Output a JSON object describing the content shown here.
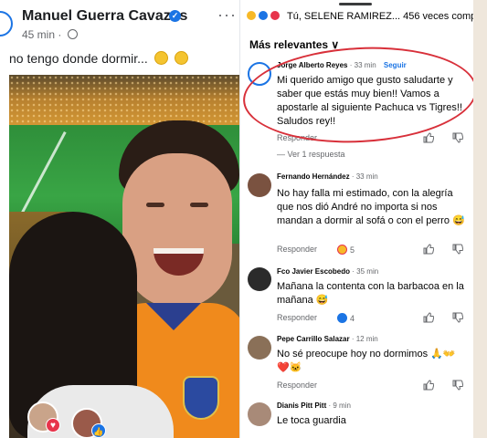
{
  "post": {
    "author": "Manuel Guerra Cavazos",
    "time": "45 min",
    "time_separator": "·",
    "caption": "no tengo donde dormir..."
  },
  "comments_panel": {
    "reactions_summary": "Tú, SELENE RAMIREZ... 456 veces comp...",
    "sort_label": "Más relevantes ∨",
    "comments": [
      {
        "name": "Jorge Alberto Reyes",
        "time": "33 min",
        "follow": "Seguir",
        "text": "Mi querido amigo que gusto saludarte y saber que estás muy bien!! Vamos a apostarle al siguiente Pachuca vs Tigres!! Saludos rey!!",
        "reply": "Responder",
        "view_replies": "Ver 1 respuesta",
        "reaction_count": ""
      },
      {
        "name": "Fernando Hernández",
        "time": "33 min",
        "text": "No hay falla mi estimado, con la alegría que nos dió André no importa si nos mandan a dormir al sofá o con el perro 😅",
        "reply": "Responder",
        "reaction_count": "5"
      },
      {
        "name": "Fco Javier Escobedo",
        "time": "35 min",
        "text": "Mañana la contenta con la barbacoa en la mañana 😅",
        "reply": "Responder",
        "reaction_count": "4"
      },
      {
        "name": "Pepe Carrillo Salazar",
        "time": "12 min",
        "text": "No sé preocupe hoy no dormimos 🙏👐 ❤️🐱",
        "reply": "Responder",
        "reaction_count": ""
      },
      {
        "name": "Dianis Pitt Pitt",
        "time": "9 min",
        "text": "Le toca guardia",
        "reply": "",
        "reaction_count": ""
      }
    ]
  },
  "colors": {
    "brand_blue": "#1b74e4",
    "highlight_red": "#d8303a",
    "secondary_text": "#65676b"
  },
  "icons": [
    "verified-badge-icon",
    "globe-icon",
    "more-options-icon",
    "like-icon",
    "dislike-icon",
    "heart-reaction-icon",
    "haha-reaction-icon"
  ]
}
